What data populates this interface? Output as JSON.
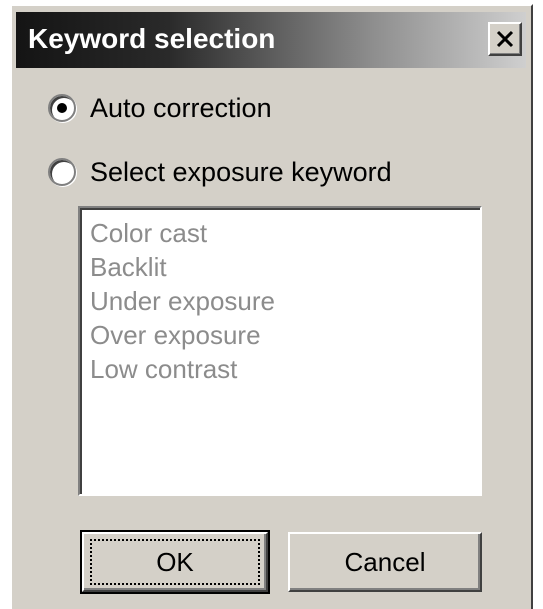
{
  "dialog": {
    "title": "Keyword selection"
  },
  "icons": {
    "close": "close-icon"
  },
  "options": {
    "auto_correction": {
      "label": "Auto correction",
      "checked": true
    },
    "select_keyword": {
      "label": "Select exposure keyword",
      "checked": false
    }
  },
  "keywords": [
    "Color cast",
    "Backlit",
    "Under exposure",
    "Over exposure",
    "Low contrast"
  ],
  "buttons": {
    "ok": "OK",
    "cancel": "Cancel"
  },
  "colors": {
    "list_disabled_text": "#8c8c8c",
    "dialog_face": "#d4d0c8"
  }
}
